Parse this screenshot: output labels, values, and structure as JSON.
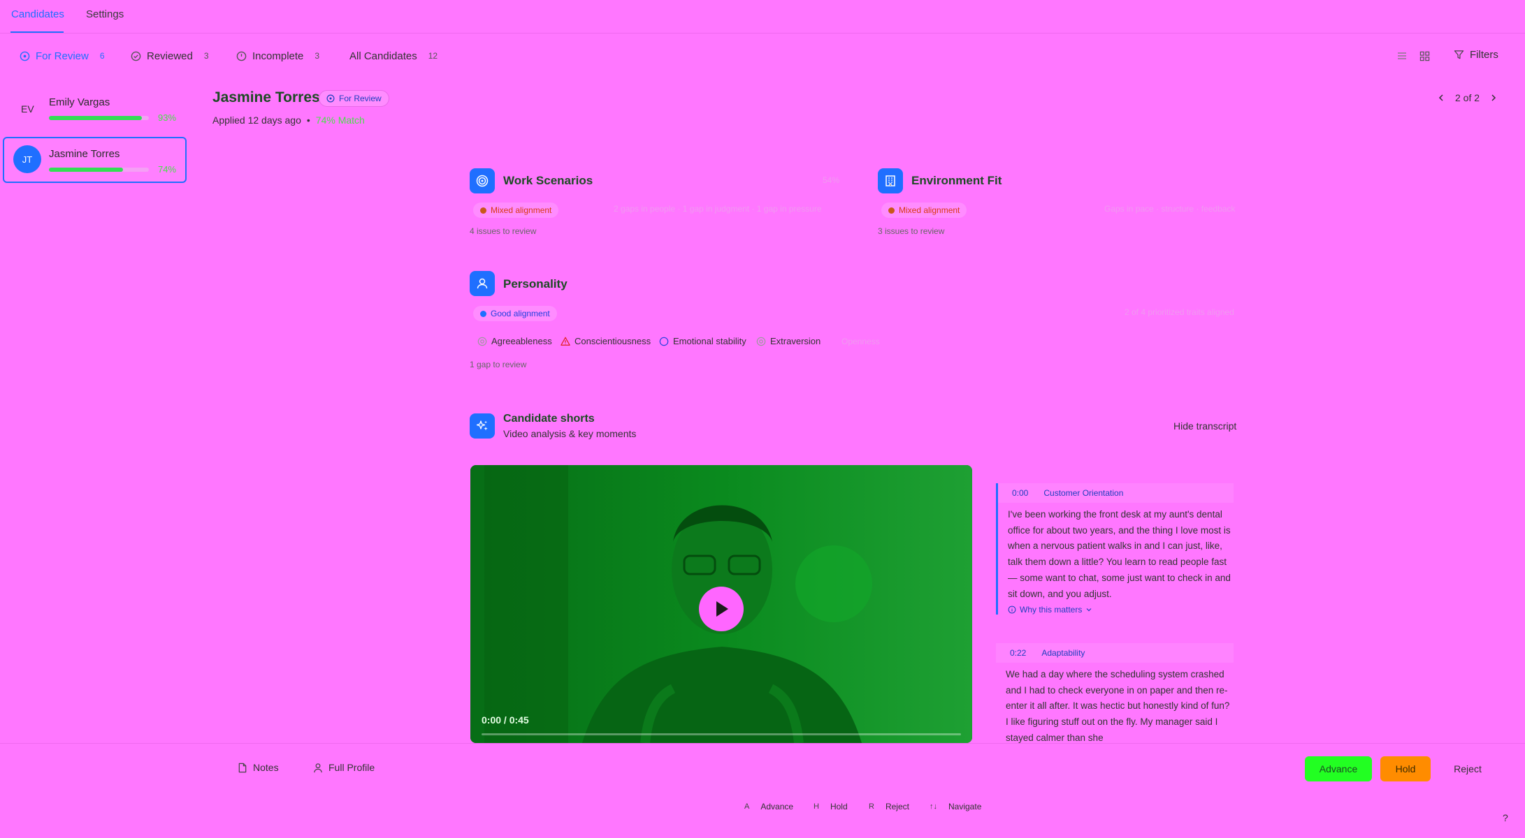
{
  "nav": {
    "tabs": [
      "Candidates",
      "Settings"
    ]
  },
  "filters": [
    {
      "label": "For Review",
      "count": "6"
    },
    {
      "label": "Reviewed",
      "count": "3"
    },
    {
      "label": "Incomplete",
      "count": "3"
    },
    {
      "label": "All Candidates",
      "count": "12"
    }
  ],
  "toolbar": {
    "filters_label": "Filters"
  },
  "candidates": [
    {
      "initials": "EV",
      "name": "Emily Vargas",
      "match_pct": "93%",
      "match_value": 0.93
    },
    {
      "initials": "JT",
      "name": "Jasmine Torres",
      "match_pct": "74%",
      "match_value": 0.74
    }
  ],
  "header": {
    "name": "Jasmine Torres",
    "status": "For Review",
    "applied": "Applied 12 days ago",
    "separator": "•",
    "match": "74% Match",
    "pager": "2 of 2"
  },
  "sections": {
    "work": {
      "title": "Work Scenarios",
      "score": "54%",
      "alignment": "Mixed alignment",
      "detail": "2 gaps in people · 1 gap in judgment · 1 gap in pressure",
      "issues": "4 issues to review"
    },
    "environment": {
      "title": "Environment Fit",
      "alignment": "Mixed alignment",
      "detail": "Gaps in pace · structure · feedback",
      "issues": "3 issues to review"
    },
    "personality": {
      "title": "Personality",
      "alignment": "Good alignment",
      "detail": "2 of 4 prioritized traits aligned",
      "traits": [
        "Agreeableness",
        "Conscientiousness",
        "Emotional stability",
        "Extraversion"
      ],
      "extra_trait": "Openness",
      "issues": "1 gap to review"
    }
  },
  "shorts": {
    "title": "Candidate shorts",
    "subtitle": "Video analysis & key moments",
    "hide_label": "Hide transcript",
    "time": "0:00 / 0:45",
    "progress": 0.0
  },
  "moments": [
    {
      "ts": "0:00",
      "category": "Customer Orientation",
      "text": "I've been working the front desk at my aunt's dental office for about two years, and the thing I love most is when a nervous patient walks in and I can just, like, talk them down a little? You learn to read people fast — some want to chat, some just want to check in and sit down, and you adjust.",
      "why": "Why this matters"
    },
    {
      "ts": "0:22",
      "category": "Adaptability",
      "text": "We had a day where the scheduling system crashed and I had to check everyone in on paper and then re-enter it all after. It was hectic but honestly kind of fun? I like figuring stuff out on the fly. My manager said I stayed calmer than she"
    }
  ],
  "actions": {
    "notes": "Notes",
    "full_profile": "Full Profile",
    "advance": "Advance",
    "hold": "Hold",
    "reject": "Reject"
  },
  "shortcuts": [
    {
      "key": "A",
      "label": "Advance"
    },
    {
      "key": "H",
      "label": "Hold"
    },
    {
      "key": "R",
      "label": "Reject"
    },
    {
      "key": "↑↓",
      "label": "Navigate"
    }
  ],
  "help": "?",
  "colors": {
    "background": "#ff77ff",
    "accent": "#1f6fff",
    "match_green": "#33dd55",
    "advance_button": "#22ff22",
    "hold_button": "#ff8c00",
    "video_tint": "#0a8a1e"
  }
}
